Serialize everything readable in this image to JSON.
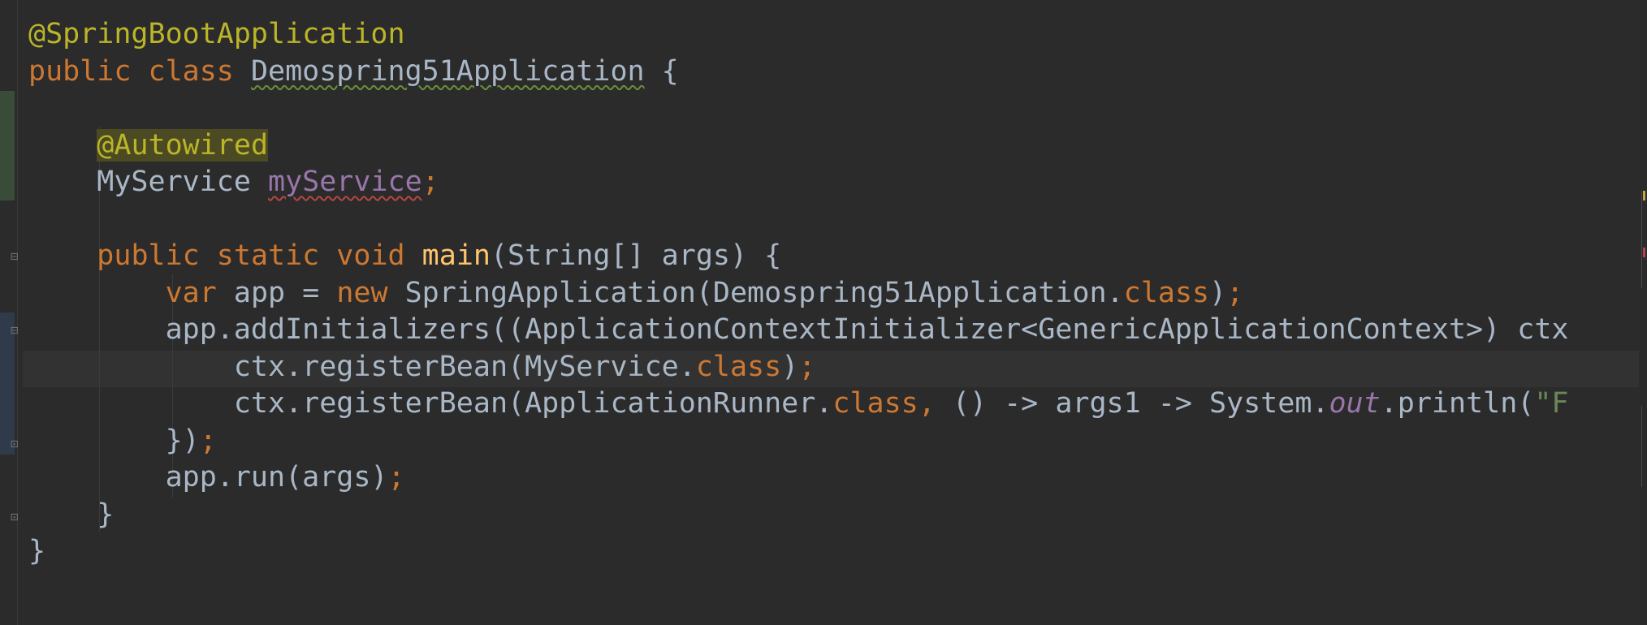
{
  "editor": {
    "theme_colors": {
      "background": "#2b2b2b",
      "keyword": "#cc7832",
      "annotation": "#bbb529",
      "plain": "#a9b7c6",
      "method": "#ffc66d",
      "field": "#9876aa",
      "string": "#6a8759"
    },
    "lines": [
      [
        {
          "text": "@SpringBootApplication",
          "type": "annotation"
        }
      ],
      [
        {
          "text": "public class ",
          "type": "keyword"
        },
        {
          "text": "Demospring51Application",
          "type": "plain",
          "squiggle": "green"
        },
        {
          "text": " {",
          "type": "plain"
        }
      ],
      [],
      [
        {
          "text": "    ",
          "type": "plain"
        },
        {
          "text": "@Autowired",
          "type": "annotation-hl"
        }
      ],
      [
        {
          "text": "    MyService ",
          "type": "plain"
        },
        {
          "text": "myService",
          "type": "field",
          "squiggle": "red"
        },
        {
          "text": ";",
          "type": "keyword"
        }
      ],
      [],
      [
        {
          "text": "    ",
          "type": "plain"
        },
        {
          "text": "public static void ",
          "type": "keyword"
        },
        {
          "text": "main",
          "type": "method"
        },
        {
          "text": "(String[] args) {",
          "type": "plain"
        }
      ],
      [
        {
          "text": "        ",
          "type": "plain"
        },
        {
          "text": "var ",
          "type": "keyword"
        },
        {
          "text": "app = ",
          "type": "plain"
        },
        {
          "text": "new ",
          "type": "keyword"
        },
        {
          "text": "SpringApplication(Demospring51Application.",
          "type": "plain"
        },
        {
          "text": "class",
          "type": "keyword"
        },
        {
          "text": ")",
          "type": "plain"
        },
        {
          "text": ";",
          "type": "keyword"
        }
      ],
      [
        {
          "text": "        app.addInitializers((ApplicationContextInitializer<GenericApplicationContext>) ctx ",
          "type": "plain"
        }
      ],
      [
        {
          "text": "            ctx.registerBean(MyService.",
          "type": "plain"
        },
        {
          "text": "class",
          "type": "keyword"
        },
        {
          "text": ")",
          "type": "plain"
        },
        {
          "text": ";",
          "type": "keyword"
        }
      ],
      [
        {
          "text": "            ctx.registerBean(ApplicationRunner.",
          "type": "plain"
        },
        {
          "text": "class",
          "type": "keyword"
        },
        {
          "text": ", ",
          "type": "keyword"
        },
        {
          "text": "() -> args1 -> System.",
          "type": "plain"
        },
        {
          "text": "out",
          "type": "static"
        },
        {
          "text": ".println(",
          "type": "plain"
        },
        {
          "text": "\"F",
          "type": "string"
        }
      ],
      [
        {
          "text": "        })",
          "type": "plain"
        },
        {
          "text": ";",
          "type": "keyword"
        }
      ],
      [
        {
          "text": "        app.run(args)",
          "type": "plain"
        },
        {
          "text": ";",
          "type": "keyword"
        }
      ],
      [
        {
          "text": "    }",
          "type": "plain"
        }
      ],
      [
        {
          "text": "}",
          "type": "plain"
        }
      ]
    ]
  }
}
